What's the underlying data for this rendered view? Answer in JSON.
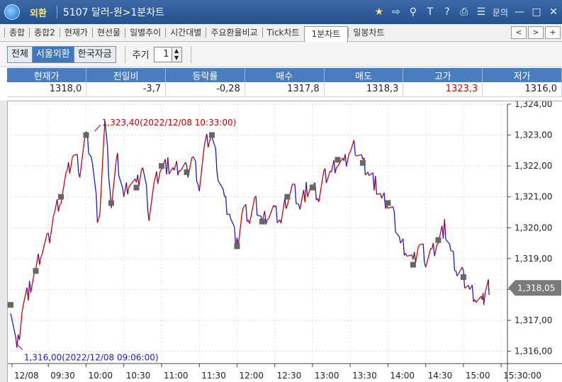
{
  "window": {
    "app_name": "외환",
    "screen_code": "5107",
    "screen_title": "달러-원>1분차트",
    "menu_label": "문의"
  },
  "tabs": [
    "종합",
    "종합2",
    "현재가",
    "현선물",
    "일별추이",
    "시간대별",
    "주요환율비교",
    "Tick차트",
    "1분차트",
    "일봉차트"
  ],
  "active_tab": "1분차트",
  "tab_nav": [
    "<",
    ">",
    "+"
  ],
  "market_filter": {
    "options": [
      "전체",
      "서울외환",
      "한국자금"
    ],
    "selected": "서울외환"
  },
  "period": {
    "label": "주기",
    "value": "1"
  },
  "quote": {
    "headers": [
      "현재가",
      "전일비",
      "등락률",
      "매수",
      "매도",
      "고가",
      "저가"
    ],
    "values": [
      "1318,0",
      "-3,7",
      "-0,28",
      "1317,8",
      "1318,3",
      "1323,3",
      "1316,0"
    ],
    "high_color": "#d40000"
  },
  "chart_data": {
    "type": "line",
    "title": "",
    "xlabel": "",
    "ylabel": "",
    "ylim": [
      1315.6,
      1324.0
    ],
    "y_ticks": [
      "1,324,00",
      "1,323,00",
      "1,322,00",
      "1,321,00",
      "1,320,00",
      "1,319,00",
      "1,318,00",
      "1,317,00",
      "1,316,00"
    ],
    "x_ticks": [
      "12/08",
      "09:30",
      "10:00",
      "10:30",
      "11:00",
      "11:30",
      "12:00",
      "12:30",
      "13:00",
      "13:30",
      "14:00",
      "14:30",
      "15:00",
      "15:30:00"
    ],
    "x_range_minutes": [
      535,
      930
    ],
    "series": [
      {
        "x": [
          535,
          540,
          545,
          550,
          555,
          560,
          565,
          570,
          575,
          580,
          585,
          590,
          595,
          600,
          605,
          610,
          615,
          620,
          625,
          630,
          635,
          640,
          645,
          650,
          655,
          660,
          665,
          670,
          675,
          680,
          685,
          690,
          695,
          700,
          705,
          710,
          715,
          720,
          725,
          730,
          735,
          740,
          745,
          750,
          755,
          760,
          765,
          770,
          775,
          780,
          785,
          790,
          795,
          800,
          805,
          810,
          815,
          820,
          825,
          830,
          835,
          840,
          845,
          850,
          855,
          860,
          865,
          870,
          875,
          880,
          885,
          890,
          895,
          900,
          905,
          910,
          913,
          916
        ],
        "y": [
          1317.5,
          1316.0,
          1317.6,
          1318.0,
          1318.6,
          1319.3,
          1319.6,
          1320.5,
          1321.0,
          1321.7,
          1322.4,
          1321.9,
          1323.0,
          1322.2,
          1320.0,
          1323.4,
          1320.8,
          1322.2,
          1321.0,
          1321.6,
          1321.3,
          1322.0,
          1320.5,
          1321.5,
          1322.0,
          1322.0,
          1321.8,
          1322.0,
          1321.8,
          1322.3,
          1321.4,
          1322.7,
          1323.0,
          1321.8,
          1320.9,
          1320.4,
          1319.4,
          1320.6,
          1320.3,
          1320.8,
          1320.2,
          1320.5,
          1320.5,
          1320.2,
          1321.0,
          1321.3,
          1320.7,
          1321.2,
          1321.3,
          1321.0,
          1321.7,
          1321.8,
          1322.2,
          1322.0,
          1322.5,
          1322.6,
          1322.1,
          1321.8,
          1321.4,
          1320.9,
          1320.8,
          1320.3,
          1319.5,
          1319.3,
          1318.8,
          1319.5,
          1319.0,
          1319.2,
          1319.6,
          1320.0,
          1319.2,
          1318.6,
          1318.4,
          1318.0,
          1317.8,
          1317.5,
          1318.05,
          1318.05
        ]
      }
    ],
    "annotations": {
      "high": "1,323,40(2022/12/08 10:33:00)",
      "low": "1,316,00(2022/12/08 09:06:00)",
      "current": "1,318,05"
    },
    "up_color": "#d40000",
    "down_color": "#1a1acc",
    "marker_color": "#666666",
    "grid": true
  }
}
